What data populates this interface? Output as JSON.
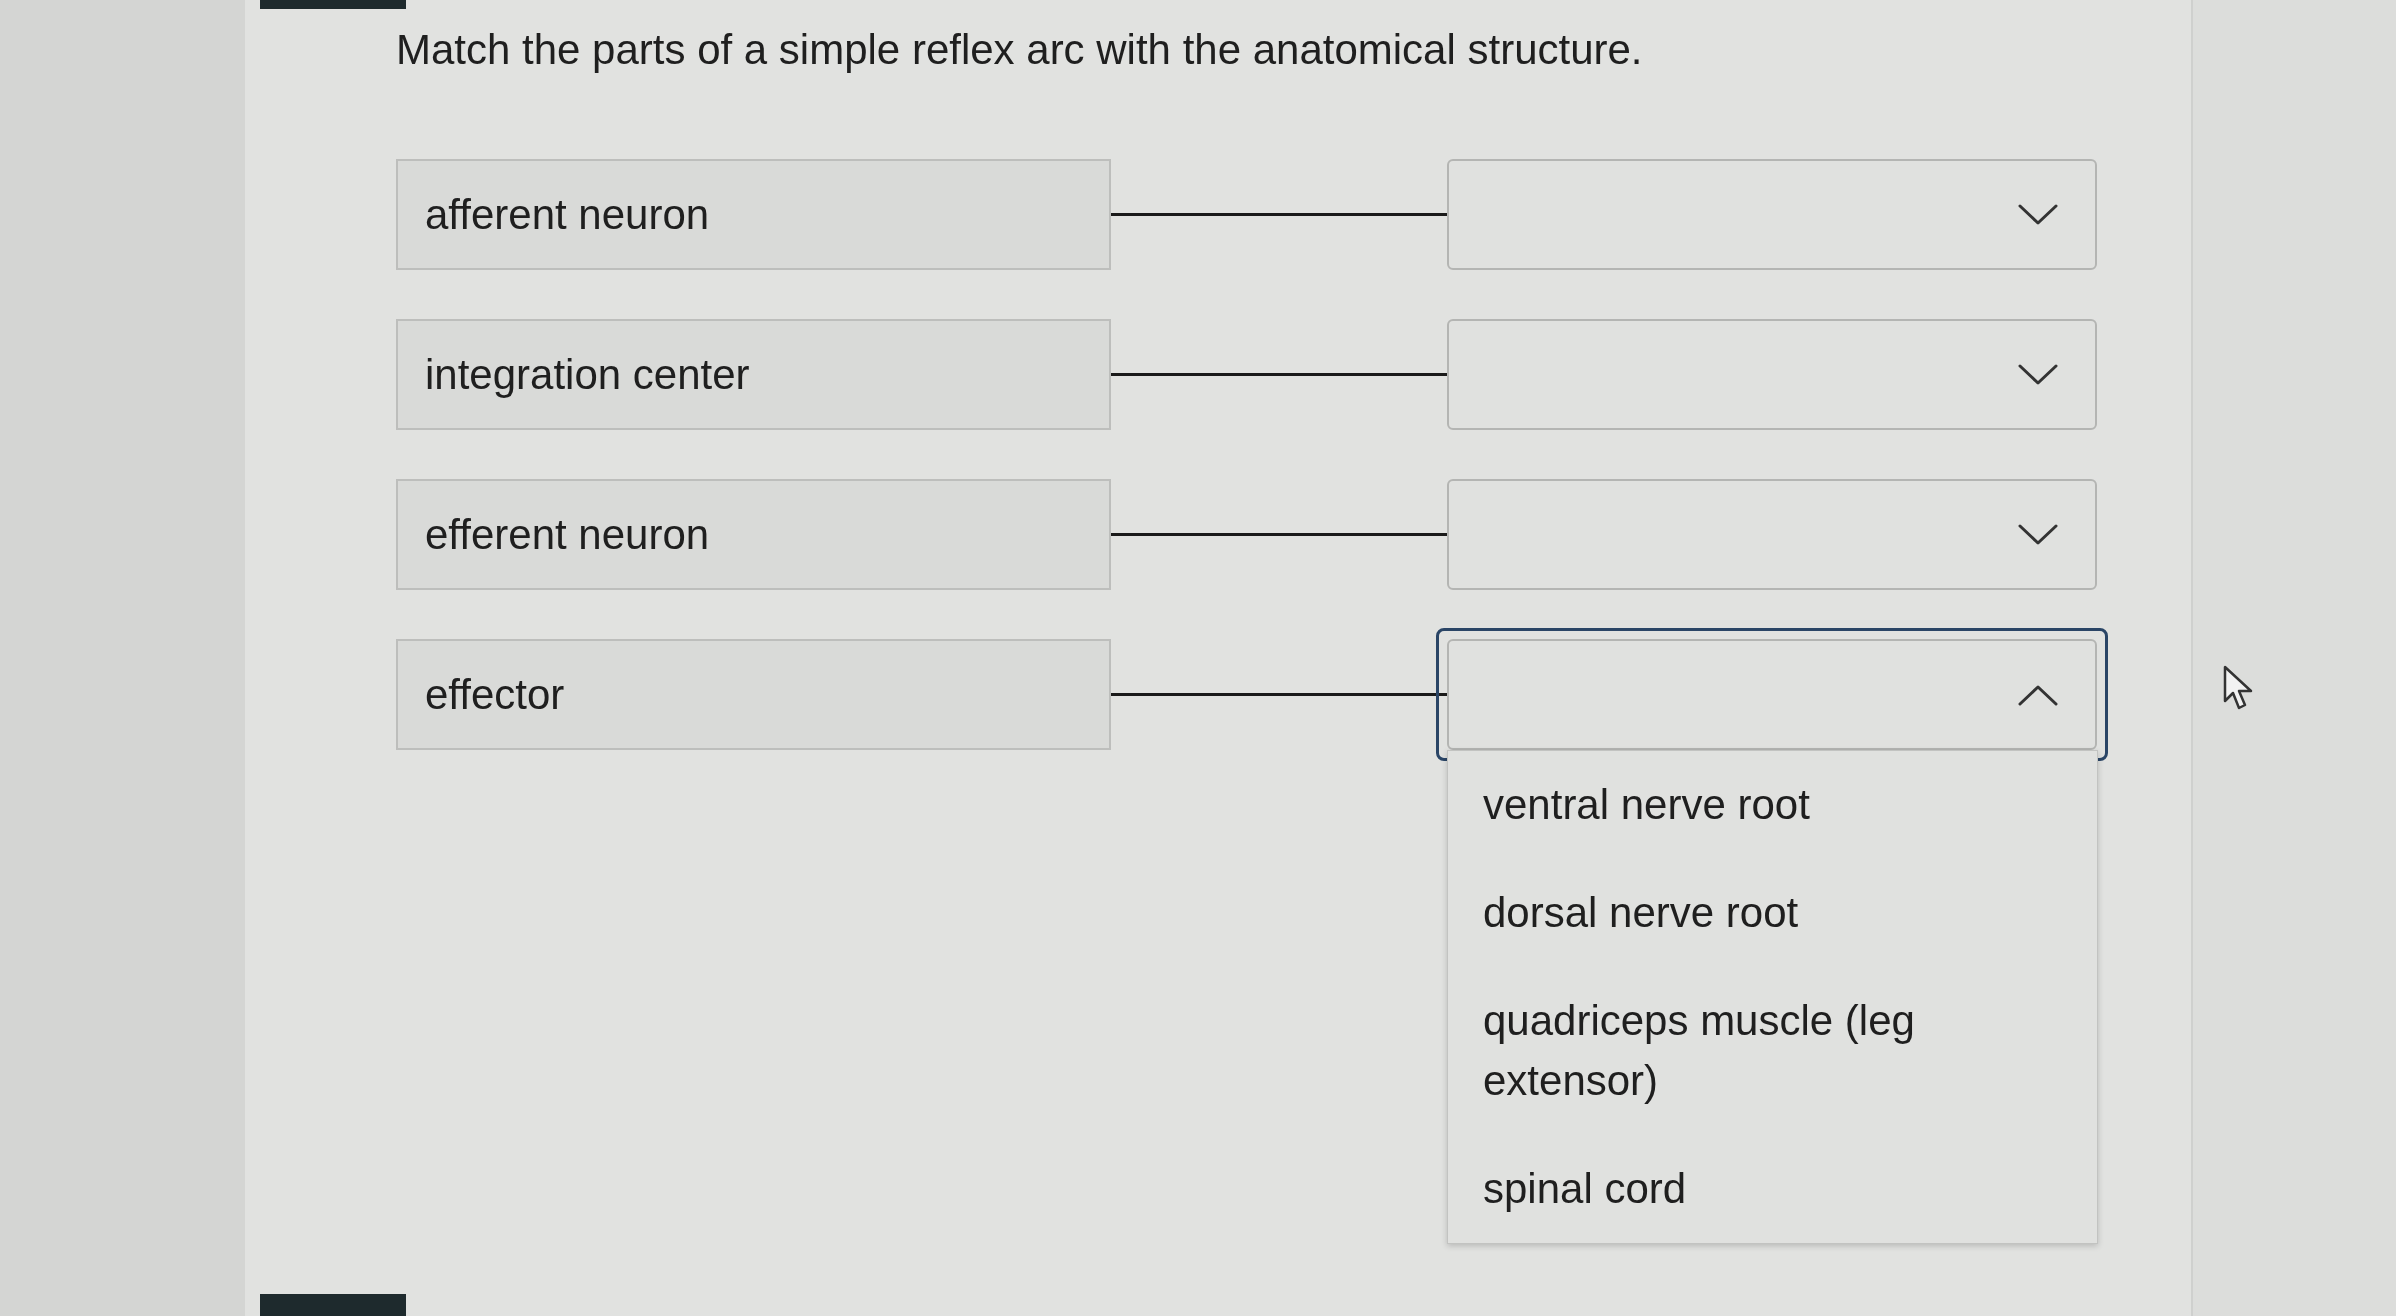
{
  "question": "Match the parts of a simple reflex arc with the anatomical structure.",
  "pairs": [
    {
      "term": "afferent neuron",
      "expanded": false
    },
    {
      "term": "integration center",
      "expanded": false
    },
    {
      "term": "efferent neuron",
      "expanded": false
    },
    {
      "term": "effector",
      "expanded": true,
      "options": [
        "ventral nerve root",
        "dorsal nerve root",
        "quadriceps muscle (leg extensor)",
        "spinal cord"
      ]
    }
  ]
}
